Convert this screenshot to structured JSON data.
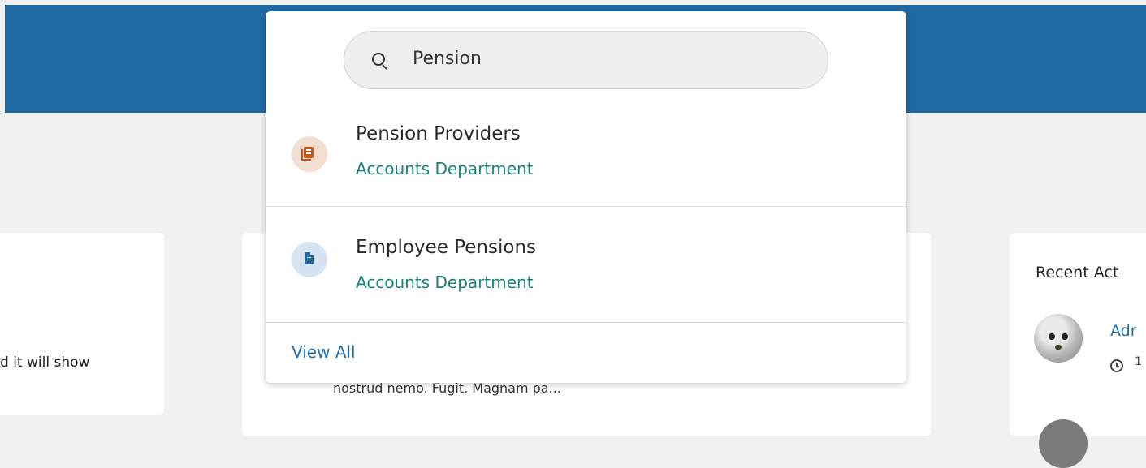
{
  "background": {
    "left_card_text": "d it will show",
    "middle_card_text": "nostrud nemo. Fugit. Magnam pa...",
    "recent_activity_title": "Recent Act",
    "recent_activity_name": "Adr",
    "recent_activity_time": "1"
  },
  "search": {
    "query": "Pension",
    "placeholder": "",
    "results": [
      {
        "icon": "book-icon",
        "title": "Pension Providers",
        "subtitle": "Accounts Department"
      },
      {
        "icon": "document-icon",
        "title": "Employee Pensions",
        "subtitle": "Accounts Department"
      }
    ],
    "view_all_label": "View All"
  },
  "colors": {
    "header": "#1f69a3",
    "accent_link": "#1f6fb0",
    "subtitle": "#168479"
  }
}
